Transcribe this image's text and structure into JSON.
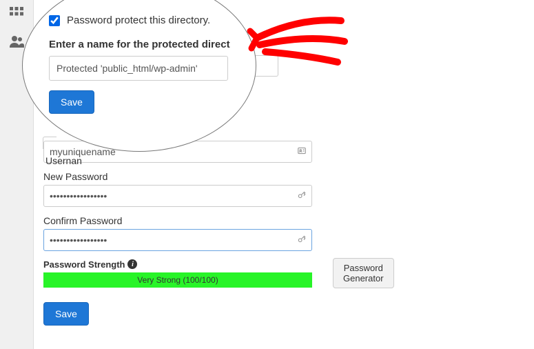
{
  "magnifier": {
    "checkbox_label": "Password protect this directory.",
    "checkbox_checked": true,
    "name_label": "Enter a name for the protected direct",
    "name_value": "Protected 'public_html/wp-admin'",
    "save_label": "Save"
  },
  "form": {
    "username_label_partial": "Usernan",
    "username_value": "myuniquename",
    "new_password_label": "New Password",
    "new_password_value": "•••••••••••••••••",
    "confirm_password_label": "Confirm Password",
    "confirm_password_value": "•••••••••••••••••",
    "strength_label": "Password Strength",
    "strength_text": "Very Strong (100/100)",
    "generator_label": "Password Generator",
    "save_label": "Save"
  }
}
